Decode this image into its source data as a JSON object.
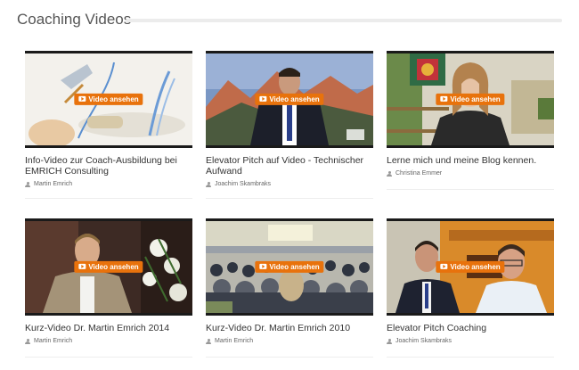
{
  "section": {
    "title": "Coaching Videos"
  },
  "play_label": "Video ansehen",
  "colors": {
    "accent": "#e8720c"
  },
  "videos": [
    {
      "title": "Info-Video zur Coach-Ausbildung bei EMRICH Consulting",
      "author": "Martin Emrich"
    },
    {
      "title": "Elevator Pitch auf Video - Technischer Aufwand",
      "author": "Joachim Skambraks"
    },
    {
      "title": "Lerne mich und meine Blog kennen.",
      "author": "Christina Emmer"
    },
    {
      "title": "Kurz-Video Dr. Martin Emrich 2014",
      "author": "Martin Emrich"
    },
    {
      "title": "Kurz-Video Dr. Martin Emrich 2010",
      "author": "Martin Emrich"
    },
    {
      "title": "Elevator Pitch Coaching",
      "author": "Joachim Skambraks"
    }
  ]
}
